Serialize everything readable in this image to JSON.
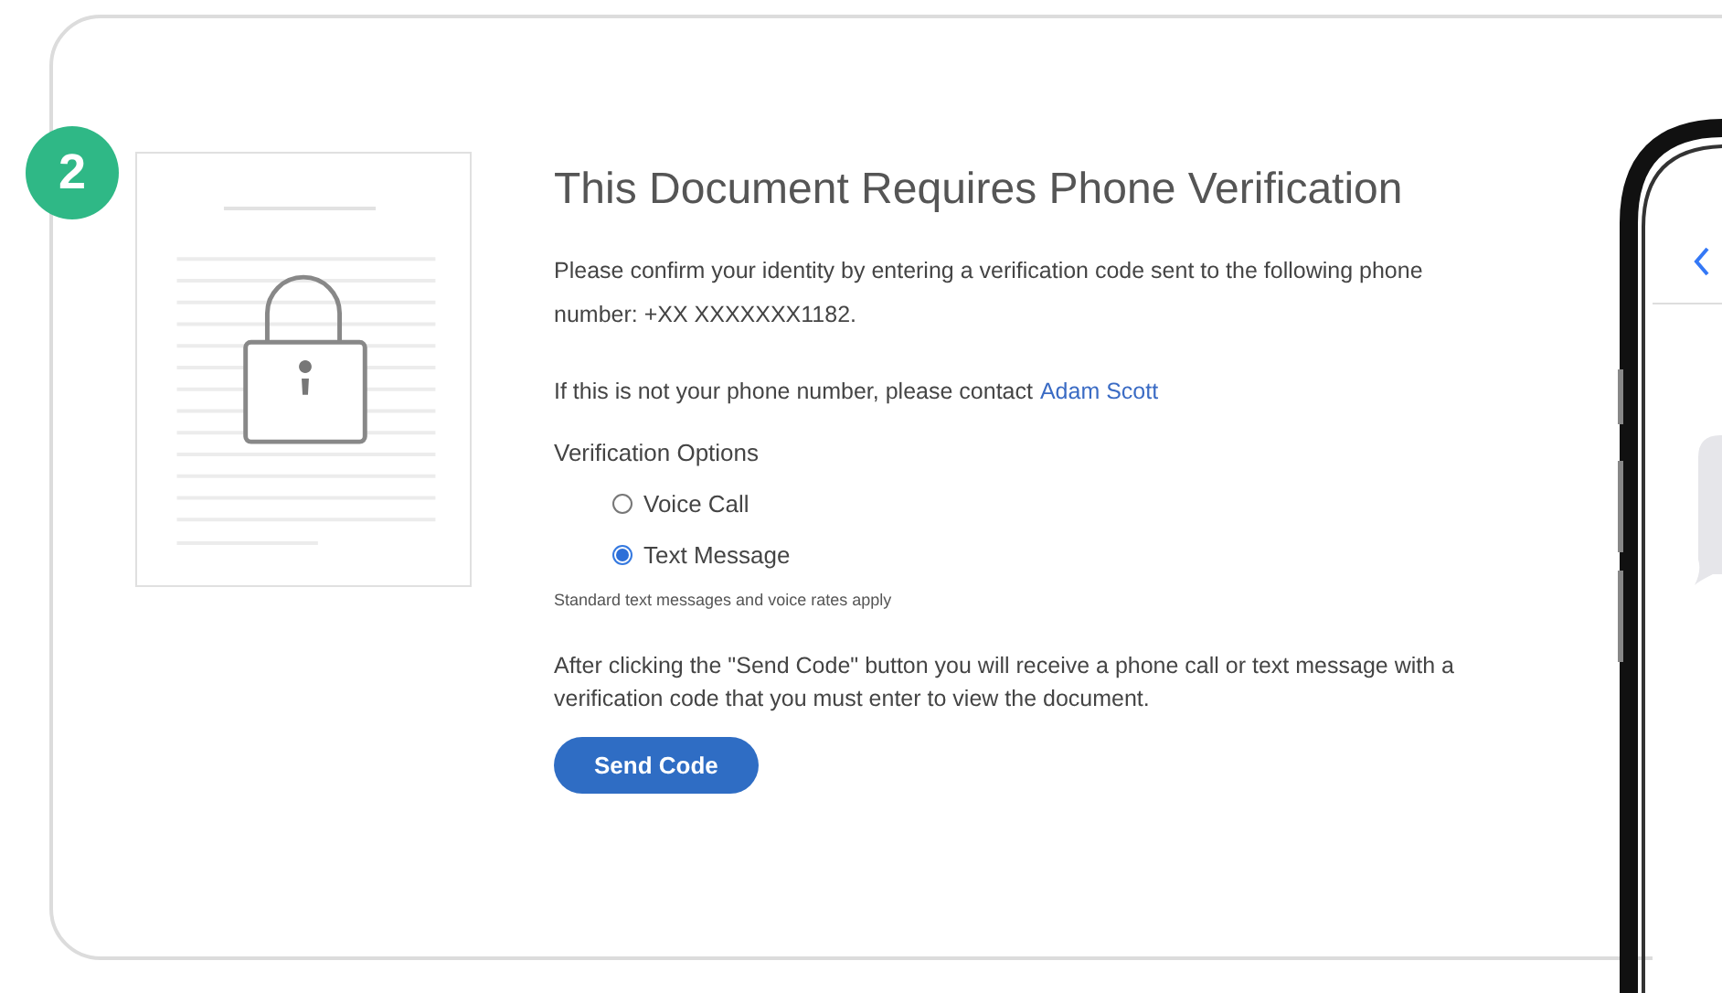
{
  "step": {
    "number": "2"
  },
  "page": {
    "title": "This Document Requires Phone Verification",
    "intro": "Please confirm your identity by entering a verification code sent to the following phone number: +XX XXXXXXX1182.",
    "contact_text": "If this is not your phone number, please contact",
    "contact_link": "Adam Scott",
    "options_heading": "Verification Options",
    "options": [
      {
        "label": "Voice Call",
        "selected": false
      },
      {
        "label": "Text Message",
        "selected": true
      }
    ],
    "rates_note": "Standard text messages and voice rates apply",
    "instructions": "After clicking the \"Send Code\" button you will receive a phone call or text message with a verification code that you must enter to view the document.",
    "button": "Send Code"
  }
}
